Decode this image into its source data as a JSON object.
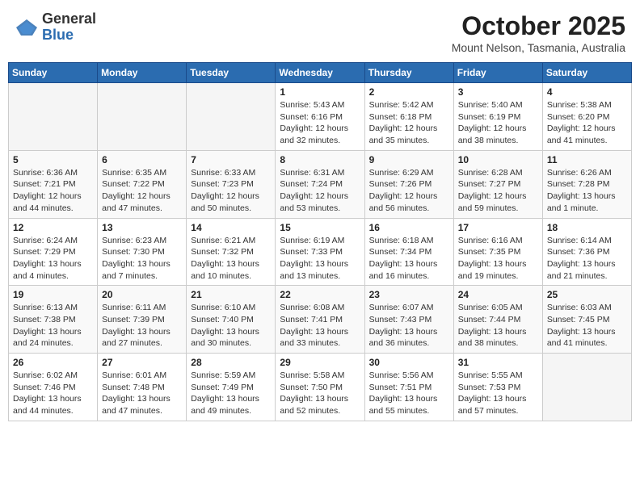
{
  "header": {
    "logo_general": "General",
    "logo_blue": "Blue",
    "month": "October 2025",
    "location": "Mount Nelson, Tasmania, Australia"
  },
  "weekdays": [
    "Sunday",
    "Monday",
    "Tuesday",
    "Wednesday",
    "Thursday",
    "Friday",
    "Saturday"
  ],
  "weeks": [
    [
      {
        "day": "",
        "info": ""
      },
      {
        "day": "",
        "info": ""
      },
      {
        "day": "",
        "info": ""
      },
      {
        "day": "1",
        "info": "Sunrise: 5:43 AM\nSunset: 6:16 PM\nDaylight: 12 hours\nand 32 minutes."
      },
      {
        "day": "2",
        "info": "Sunrise: 5:42 AM\nSunset: 6:18 PM\nDaylight: 12 hours\nand 35 minutes."
      },
      {
        "day": "3",
        "info": "Sunrise: 5:40 AM\nSunset: 6:19 PM\nDaylight: 12 hours\nand 38 minutes."
      },
      {
        "day": "4",
        "info": "Sunrise: 5:38 AM\nSunset: 6:20 PM\nDaylight: 12 hours\nand 41 minutes."
      }
    ],
    [
      {
        "day": "5",
        "info": "Sunrise: 6:36 AM\nSunset: 7:21 PM\nDaylight: 12 hours\nand 44 minutes."
      },
      {
        "day": "6",
        "info": "Sunrise: 6:35 AM\nSunset: 7:22 PM\nDaylight: 12 hours\nand 47 minutes."
      },
      {
        "day": "7",
        "info": "Sunrise: 6:33 AM\nSunset: 7:23 PM\nDaylight: 12 hours\nand 50 minutes."
      },
      {
        "day": "8",
        "info": "Sunrise: 6:31 AM\nSunset: 7:24 PM\nDaylight: 12 hours\nand 53 minutes."
      },
      {
        "day": "9",
        "info": "Sunrise: 6:29 AM\nSunset: 7:26 PM\nDaylight: 12 hours\nand 56 minutes."
      },
      {
        "day": "10",
        "info": "Sunrise: 6:28 AM\nSunset: 7:27 PM\nDaylight: 12 hours\nand 59 minutes."
      },
      {
        "day": "11",
        "info": "Sunrise: 6:26 AM\nSunset: 7:28 PM\nDaylight: 13 hours\nand 1 minute."
      }
    ],
    [
      {
        "day": "12",
        "info": "Sunrise: 6:24 AM\nSunset: 7:29 PM\nDaylight: 13 hours\nand 4 minutes."
      },
      {
        "day": "13",
        "info": "Sunrise: 6:23 AM\nSunset: 7:30 PM\nDaylight: 13 hours\nand 7 minutes."
      },
      {
        "day": "14",
        "info": "Sunrise: 6:21 AM\nSunset: 7:32 PM\nDaylight: 13 hours\nand 10 minutes."
      },
      {
        "day": "15",
        "info": "Sunrise: 6:19 AM\nSunset: 7:33 PM\nDaylight: 13 hours\nand 13 minutes."
      },
      {
        "day": "16",
        "info": "Sunrise: 6:18 AM\nSunset: 7:34 PM\nDaylight: 13 hours\nand 16 minutes."
      },
      {
        "day": "17",
        "info": "Sunrise: 6:16 AM\nSunset: 7:35 PM\nDaylight: 13 hours\nand 19 minutes."
      },
      {
        "day": "18",
        "info": "Sunrise: 6:14 AM\nSunset: 7:36 PM\nDaylight: 13 hours\nand 21 minutes."
      }
    ],
    [
      {
        "day": "19",
        "info": "Sunrise: 6:13 AM\nSunset: 7:38 PM\nDaylight: 13 hours\nand 24 minutes."
      },
      {
        "day": "20",
        "info": "Sunrise: 6:11 AM\nSunset: 7:39 PM\nDaylight: 13 hours\nand 27 minutes."
      },
      {
        "day": "21",
        "info": "Sunrise: 6:10 AM\nSunset: 7:40 PM\nDaylight: 13 hours\nand 30 minutes."
      },
      {
        "day": "22",
        "info": "Sunrise: 6:08 AM\nSunset: 7:41 PM\nDaylight: 13 hours\nand 33 minutes."
      },
      {
        "day": "23",
        "info": "Sunrise: 6:07 AM\nSunset: 7:43 PM\nDaylight: 13 hours\nand 36 minutes."
      },
      {
        "day": "24",
        "info": "Sunrise: 6:05 AM\nSunset: 7:44 PM\nDaylight: 13 hours\nand 38 minutes."
      },
      {
        "day": "25",
        "info": "Sunrise: 6:03 AM\nSunset: 7:45 PM\nDaylight: 13 hours\nand 41 minutes."
      }
    ],
    [
      {
        "day": "26",
        "info": "Sunrise: 6:02 AM\nSunset: 7:46 PM\nDaylight: 13 hours\nand 44 minutes."
      },
      {
        "day": "27",
        "info": "Sunrise: 6:01 AM\nSunset: 7:48 PM\nDaylight: 13 hours\nand 47 minutes."
      },
      {
        "day": "28",
        "info": "Sunrise: 5:59 AM\nSunset: 7:49 PM\nDaylight: 13 hours\nand 49 minutes."
      },
      {
        "day": "29",
        "info": "Sunrise: 5:58 AM\nSunset: 7:50 PM\nDaylight: 13 hours\nand 52 minutes."
      },
      {
        "day": "30",
        "info": "Sunrise: 5:56 AM\nSunset: 7:51 PM\nDaylight: 13 hours\nand 55 minutes."
      },
      {
        "day": "31",
        "info": "Sunrise: 5:55 AM\nSunset: 7:53 PM\nDaylight: 13 hours\nand 57 minutes."
      },
      {
        "day": "",
        "info": ""
      }
    ]
  ]
}
